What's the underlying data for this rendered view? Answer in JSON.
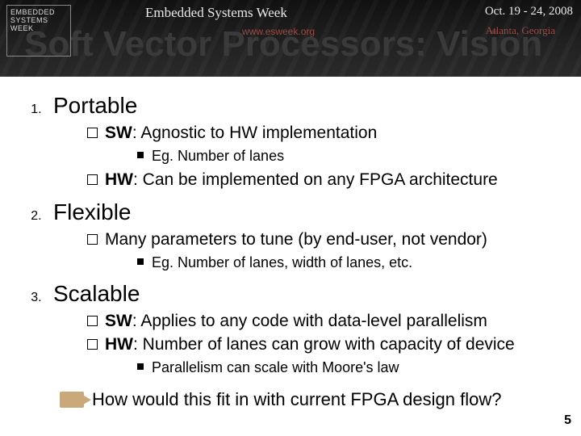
{
  "banner": {
    "logo_l1": "EMBEDDED",
    "logo_l2": "SYSTEMS",
    "logo_l3": "WEEK",
    "event": "Embedded Systems Week",
    "dates": "Oct. 19 - 24, 2008",
    "url": "www.esweek.org",
    "location": "Atlanta, Georgia"
  },
  "title": "Soft Vector Processors: Vision",
  "list": {
    "n1": "1.",
    "h1": "Portable",
    "p1a_prefix": "SW",
    "p1a_rest": ": Agnostic to HW implementation",
    "p1a_eg": "Eg. Number of lanes",
    "p1b_prefix": "HW",
    "p1b_rest": ": Can be implemented on any FPGA architecture",
    "n2": "2.",
    "h2": "Flexible",
    "p2a": "Many parameters to tune (by end-user, not vendor)",
    "p2a_eg": "Eg. Number of lanes, width of lanes, etc.",
    "n3": "3.",
    "h3": "Scalable",
    "p3a_prefix": "SW",
    "p3a_rest": ": Applies to any code with data-level parallelism",
    "p3b_prefix": "HW",
    "p3b_rest": ": Number of lanes can grow with capacity of device",
    "p3b_eg": "Parallelism can scale with Moore's law"
  },
  "final": "How would this fit in with current FPGA design flow?",
  "pagenum": "5"
}
